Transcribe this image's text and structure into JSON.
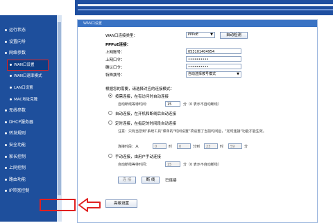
{
  "sidebar": {
    "items": [
      {
        "label": "运行状态"
      },
      {
        "label": "设置向导"
      },
      {
        "label": "网络参数"
      },
      {
        "label": "WAN口设置",
        "sub": true,
        "selected": true
      },
      {
        "label": "WAN口速率模式",
        "sub": true
      },
      {
        "label": "LAN口设置",
        "sub": true
      },
      {
        "label": "MAC地址克隆",
        "sub": true
      },
      {
        "label": "无线参数"
      },
      {
        "label": "DHCP服务器"
      },
      {
        "label": "转发规则"
      },
      {
        "label": "安全功能"
      },
      {
        "label": "家长控制"
      },
      {
        "label": "上网控制"
      },
      {
        "label": "路由功能"
      },
      {
        "label": "IP带宽控制"
      }
    ]
  },
  "panel": {
    "title": "WAN口设置",
    "wan_type_label": "WAN口连接类型：",
    "wan_type_value": "PPPoE",
    "auto_detect_button": "自动检测",
    "pppoe_label": "PPPoE连接：",
    "account_label": "上网账号：",
    "account_value": "053101404954",
    "password_label": "上网口令：",
    "password_value": "••••••••••",
    "confirm_label": "确认口令：",
    "confirm_value": "••••••••••",
    "special_dial_label": "特殊拨号：",
    "special_dial_value": "自动选择拨号模式",
    "mode_hint": "根据您的需要，请选择对应的连接模式：",
    "mode_demand_label": "按需连接，在有访问时自动连接",
    "demand_idle_label": "自动断线等待时间：",
    "demand_idle_value": "15",
    "demand_idle_suffix": "分（0 表示不自动断线）",
    "mode_auto_label": "自动连接，在开机和断线后自动连接",
    "mode_timed_label": "定时连接，在指定的时间段自动连接",
    "timed_note": "注意：只有当您到\"系统工具\"菜单的\"时间设置\"项设置了当前时间后，\"定时连接\"功能才能生效。",
    "timed_range_label": "连接时段：从",
    "timed_from_h": "0",
    "timed_hour_text": "时",
    "timed_from_m": "0",
    "timed_min_text": "分到",
    "timed_to_h": "23",
    "timed_to_m": "59",
    "timed_end_text": "分",
    "mode_manual_label": "手动连接，由用户手动连接",
    "manual_idle_label": "自动断线等待时间：",
    "manual_idle_value": "15",
    "manual_idle_suffix": "分（0 表示不自动断线）",
    "connect_button": "连 接",
    "disconnect_button": "断 线",
    "status_text": "已连接",
    "advanced_button": "高级设置"
  },
  "colors": {
    "sidebar_bg": "#1e4f9c",
    "banner_bg": "#1f4fa0",
    "highlight_red": "#e02020",
    "panel_header": "#3a73c4"
  }
}
